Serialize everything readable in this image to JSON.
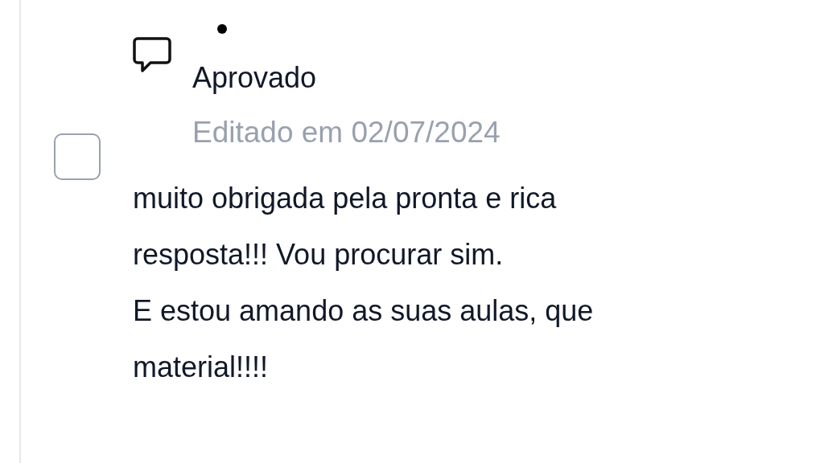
{
  "comment": {
    "status": "Aprovado",
    "edited": "Editado em 02/07/2024",
    "checked": false,
    "body": [
      "muito obrigada pela pronta e rica",
      "resposta!!! Vou procurar sim.",
      "E estou amando as suas aulas, que",
      "material!!!!"
    ]
  }
}
